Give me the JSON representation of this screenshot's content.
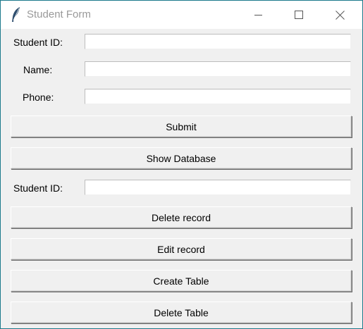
{
  "window": {
    "title": "Student Form",
    "controls": {
      "minimize_icon": "minimize-icon",
      "maximize_icon": "maximize-icon",
      "close_icon": "close-icon"
    },
    "app_icon": "feather-icon"
  },
  "form": {
    "student_id_label": "Student ID:",
    "student_id_value": "",
    "name_label": "Name:",
    "name_value": "",
    "phone_label": "Phone:",
    "phone_value": "",
    "submit_label": "Submit",
    "show_database_label": "Show Database"
  },
  "delete_section": {
    "student_id_label": "Student ID:",
    "student_id_value": "",
    "delete_record_label": "Delete record",
    "edit_record_label": "Edit record",
    "create_table_label": "Create Table",
    "delete_table_label": "Delete Table"
  },
  "colors": {
    "window_border": "#1c7a8c",
    "window_bg": "#f0f0f0",
    "titlebar_bg": "#ffffff",
    "title_text": "#999999"
  }
}
